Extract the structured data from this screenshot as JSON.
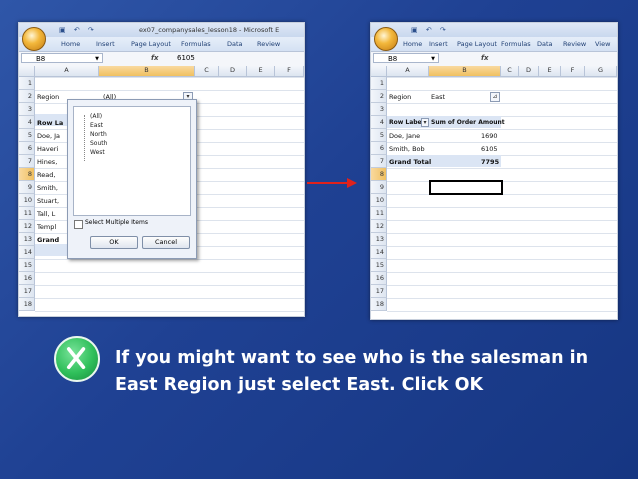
{
  "left_window": {
    "title": "ex07_companysales_lesson18 - Microsoft E",
    "ribbon_tabs": [
      "Home",
      "Insert",
      "Page Layout",
      "Formulas",
      "Data",
      "Review"
    ],
    "name_box": "B8",
    "fx": "fx",
    "formula_value": "6105",
    "columns": [
      "A",
      "B",
      "C",
      "D",
      "E",
      "F"
    ],
    "rows": [
      "1",
      "2",
      "3",
      "4",
      "5",
      "6",
      "7",
      "8",
      "9",
      "10",
      "11",
      "12",
      "13",
      "14",
      "15",
      "16",
      "17",
      "18"
    ],
    "cells": {
      "a1": "Region",
      "b1": "(All)",
      "a3": "Row La",
      "a4": "Doe, Ja",
      "a5": "Haveri",
      "a6": "Hines,",
      "a7": "Read,",
      "a8": "Smith,",
      "a9": "Stuart,",
      "a10": "Tall, L",
      "a11": "Templ",
      "a12": "Grand"
    },
    "filter_dialog": {
      "items": [
        "(All)",
        "East",
        "North",
        "South",
        "West"
      ],
      "select_multiple_label": "Select Multiple Items",
      "ok_label": "OK",
      "cancel_label": "Cancel"
    }
  },
  "right_window": {
    "ribbon_tabs": [
      "Home",
      "Insert",
      "Page Layout",
      "Formulas",
      "Data",
      "Review",
      "View"
    ],
    "name_box": "B8",
    "fx": "fx",
    "columns": [
      "A",
      "B",
      "C",
      "D",
      "E",
      "F",
      "G"
    ],
    "rows": [
      "1",
      "2",
      "3",
      "4",
      "5",
      "6",
      "7",
      "8",
      "9",
      "10",
      "11",
      "12",
      "13",
      "14",
      "15",
      "16",
      "17",
      "18"
    ],
    "cells": {
      "a1": "Region",
      "b1": "East",
      "a3": "Row Labels",
      "b3": "Sum of Order Amount",
      "a4": "Doe, Jane",
      "b4": "1690",
      "a5": "Smith, Bob",
      "b5": "6105",
      "a6": "Grand Total",
      "b6": "7795"
    }
  },
  "caption": {
    "icon": "x-close-icon",
    "text": "If you might want to see who is the salesman in East Region just select East. Click OK"
  },
  "colors": {
    "arrow": "#e0221b",
    "bullet": "#2fbf5a"
  }
}
